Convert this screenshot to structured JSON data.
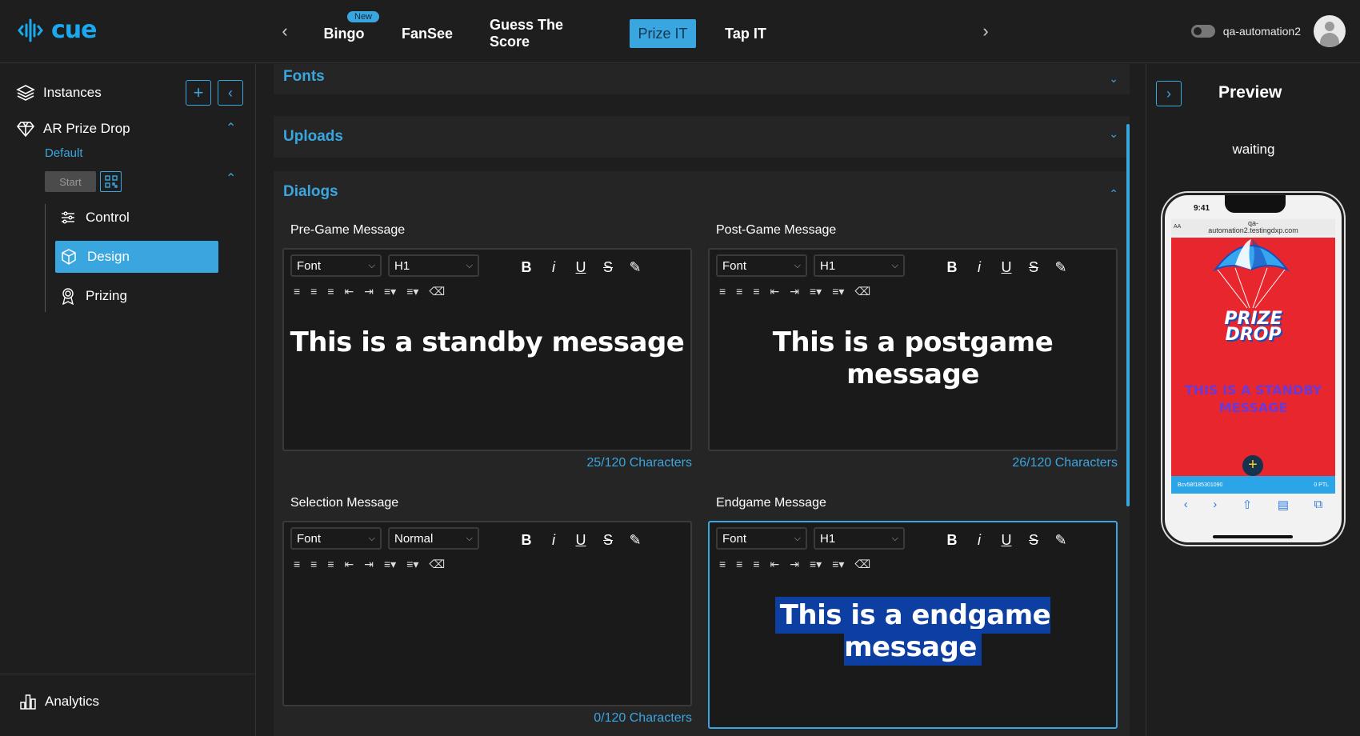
{
  "app": {
    "logo_text": "cue",
    "accent_color": "#3aa6e0"
  },
  "top_nav": {
    "tabs": [
      {
        "label": "Bingo",
        "badge": "New"
      },
      {
        "label": "FanSee"
      },
      {
        "label": "Guess The Score"
      },
      {
        "label": "Prize IT",
        "active": true
      },
      {
        "label": "Tap IT"
      }
    ],
    "username": "qa-automation2"
  },
  "sidebar": {
    "instances_label": "Instances",
    "game_label": "AR Prize Drop",
    "instance_label": "Default",
    "start_label": "Start",
    "menu": [
      {
        "label": "Control",
        "icon": "sliders-icon"
      },
      {
        "label": "Design",
        "icon": "cube-icon",
        "active": true
      },
      {
        "label": "Prizing",
        "icon": "award-icon"
      }
    ],
    "analytics_label": "Analytics"
  },
  "sections": {
    "fonts": "Fonts",
    "uploads": "Uploads",
    "dialogs": "Dialogs"
  },
  "editors": [
    {
      "label": "Pre-Game Message",
      "font": "Font",
      "size": "H1",
      "content": "This is a standby message",
      "count": "25/120 Characters"
    },
    {
      "label": "Post-Game Message",
      "font": "Font",
      "size": "H1",
      "content": "This is a postgame message",
      "count": "26/120 Characters"
    },
    {
      "label": "Selection Message",
      "font": "Font",
      "size": "Normal",
      "content": "",
      "count": "0/120 Characters"
    },
    {
      "label": "Endgame Message",
      "font": "Font",
      "size": "H1",
      "content": "This is a endgame message",
      "count": ""
    }
  ],
  "preview": {
    "title": "Preview",
    "status": "waiting",
    "phone": {
      "time": "9:41",
      "url_line1": "qa-",
      "url_line2": "automation2.testingdxp.com",
      "url_prefix": "AA",
      "brand_line1": "PRIZE",
      "brand_line2": "DROP",
      "message_line1": "THIS IS A STANDBY",
      "message_line2": "MESSAGE",
      "footer_left": "Bcv58f185301090",
      "footer_right": "0 PTL"
    }
  }
}
